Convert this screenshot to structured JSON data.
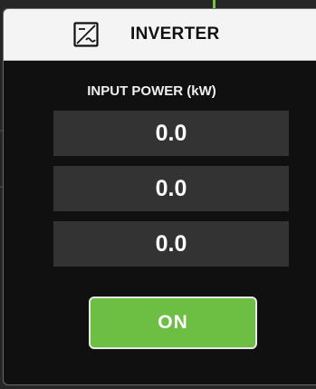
{
  "panel": {
    "title": "INVERTER",
    "icon": "inverter-icon",
    "section_label": "INPUT POWER (kW)",
    "values": [
      "0.0",
      "0.0",
      "0.0"
    ],
    "button_label": "ON"
  },
  "colors": {
    "header_bg": "#f4f4f4",
    "panel_bg": "#101010",
    "value_bg": "#333333",
    "button_bg": "#6cbf43",
    "accent_tick": "#7bc043"
  }
}
